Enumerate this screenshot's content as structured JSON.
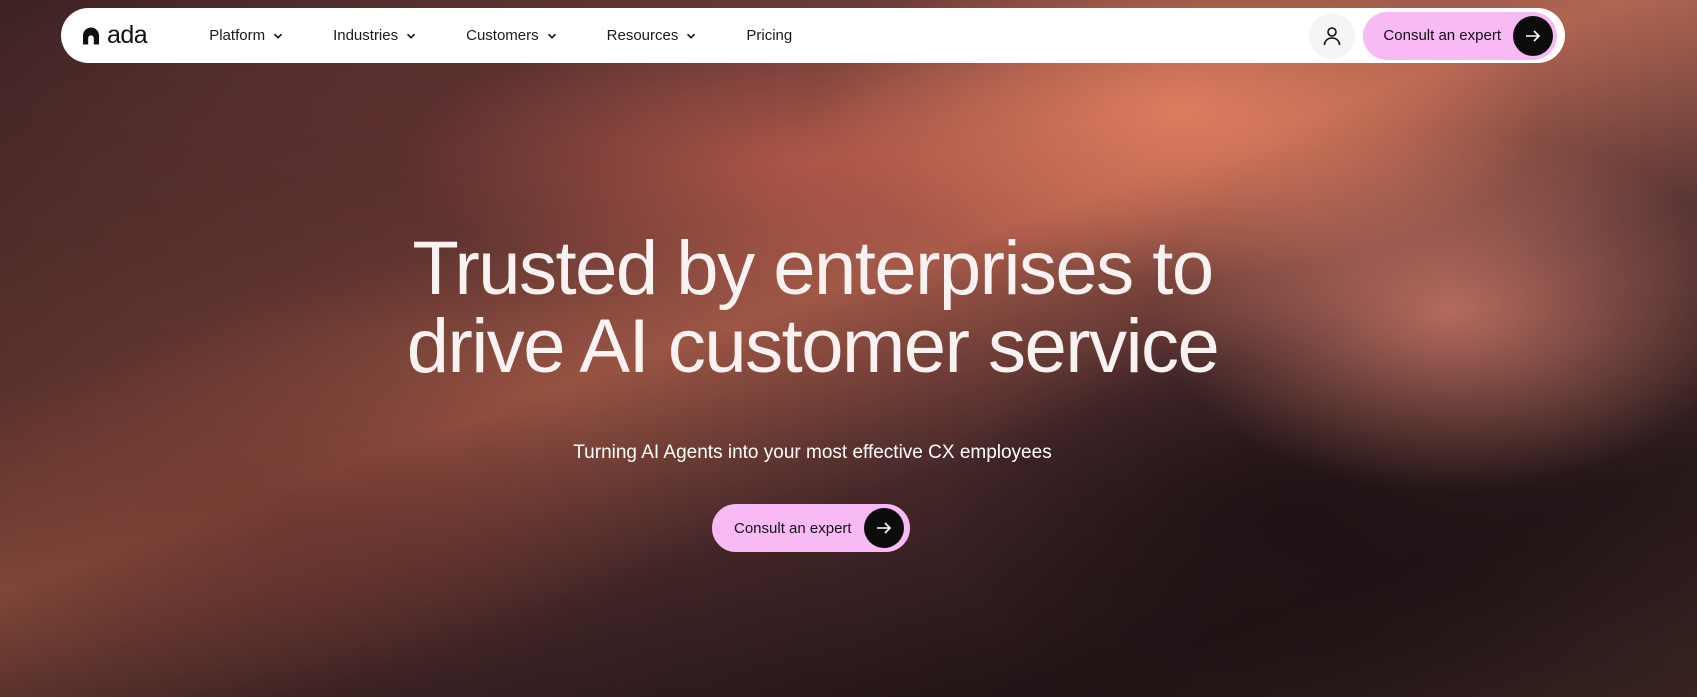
{
  "brand": {
    "name": "ada"
  },
  "nav": {
    "items": [
      {
        "label": "Platform",
        "has_dropdown": true
      },
      {
        "label": "Industries",
        "has_dropdown": true
      },
      {
        "label": "Customers",
        "has_dropdown": true
      },
      {
        "label": "Resources",
        "has_dropdown": true
      },
      {
        "label": "Pricing",
        "has_dropdown": false
      }
    ],
    "account_icon": "user-icon",
    "cta_label": "Consult an expert",
    "cta_icon": "arrow-right-icon"
  },
  "hero": {
    "headline_line1": "Trusted by enterprises to",
    "headline_line2": "drive AI customer service",
    "subheadline": "Turning AI Agents into your most effective CX employees",
    "cta_label": "Consult an expert",
    "cta_icon": "arrow-right-icon"
  },
  "colors": {
    "cta_background": "#f7baf5",
    "cta_arrow_background": "#0c0c0c",
    "nav_background": "#ffffff",
    "headline_text": "#f8f3f2"
  }
}
